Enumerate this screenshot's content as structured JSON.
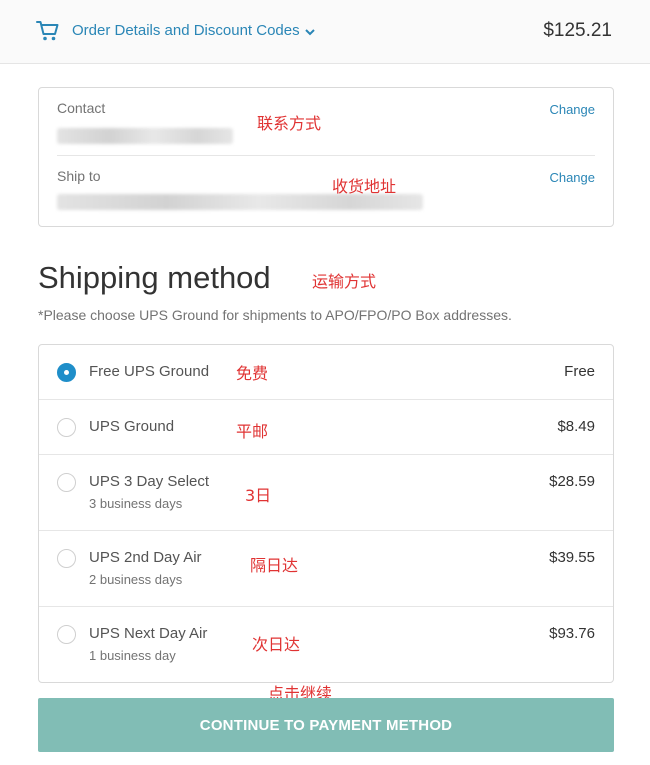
{
  "header": {
    "cart_icon": "cart-icon",
    "summary_toggle_label": "Order Details and Discount Codes",
    "total": "$125.21",
    "accent_color": "#2a86b6"
  },
  "review": {
    "contact": {
      "label": "Contact",
      "change_label": "Change",
      "annotation": "联系方式"
    },
    "ship_to": {
      "label": "Ship to",
      "change_label": "Change",
      "annotation": "收货地址"
    }
  },
  "shipping": {
    "title": "Shipping method",
    "title_annotation": "运输方式",
    "note": "*Please choose UPS Ground for shipments to APO/FPO/PO Box addresses.",
    "methods": [
      {
        "name": "Free UPS Ground",
        "sub": "",
        "price": "Free",
        "annotation": "免费",
        "selected": true
      },
      {
        "name": "UPS Ground",
        "sub": "",
        "price": "$8.49",
        "annotation": "平邮",
        "selected": false
      },
      {
        "name": "UPS 3 Day Select",
        "sub": "3 business days",
        "price": "$28.59",
        "annotation": "3日",
        "selected": false
      },
      {
        "name": "UPS 2nd Day Air",
        "sub": "2 business days",
        "price": "$39.55",
        "annotation": "隔日达",
        "selected": false
      },
      {
        "name": "UPS Next Day Air",
        "sub": "1 business day",
        "price": "$93.76",
        "annotation": "次日达",
        "selected": false
      }
    ]
  },
  "continue": {
    "label": "CONTINUE TO PAYMENT METHOD",
    "annotation": "点击继续",
    "button_color": "#81bdb5"
  },
  "annotation_color": "#e03333"
}
